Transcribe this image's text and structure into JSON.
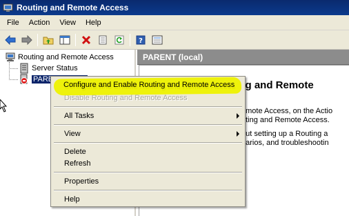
{
  "window": {
    "title": "Routing and Remote Access"
  },
  "menubar": {
    "items": [
      "File",
      "Action",
      "View",
      "Help"
    ]
  },
  "toolbar": {
    "buttons": [
      "back-arrow-icon",
      "forward-arrow-icon",
      "up-folder-icon",
      "show-hide-tree-icon",
      "delete-icon",
      "properties-icon",
      "refresh-icon",
      "help-icon",
      "export-list-icon"
    ]
  },
  "tree": {
    "root": "Routing and Remote Access",
    "server_status": "Server Status",
    "selected_node": "PARENT (local)"
  },
  "right_pane": {
    "header": "PARENT (local)",
    "heading": "uting and Remote",
    "lines": [
      "emote Access, on the Actio",
      "uting and Remote Access.",
      "out setting up a Routing a",
      "narios, and troubleshootin"
    ]
  },
  "context_menu": {
    "items": [
      {
        "label": "Configure and Enable Routing and Remote Access",
        "enabled": true
      },
      {
        "label": "Disable Routing and Remote Access",
        "enabled": false
      },
      {
        "label": "All Tasks",
        "enabled": true,
        "submenu": true
      },
      {
        "label": "View",
        "enabled": true,
        "submenu": true
      },
      {
        "label": "Delete",
        "enabled": true
      },
      {
        "label": "Refresh",
        "enabled": true
      },
      {
        "label": "Properties",
        "enabled": true
      },
      {
        "label": "Help",
        "enabled": true
      }
    ],
    "highlight_color": "#eef200"
  },
  "colors": {
    "title_bar": "#0b3a8c",
    "chrome": "#ece9d8",
    "pane_header": "#8c8c8c",
    "selection": "#0a246a"
  }
}
